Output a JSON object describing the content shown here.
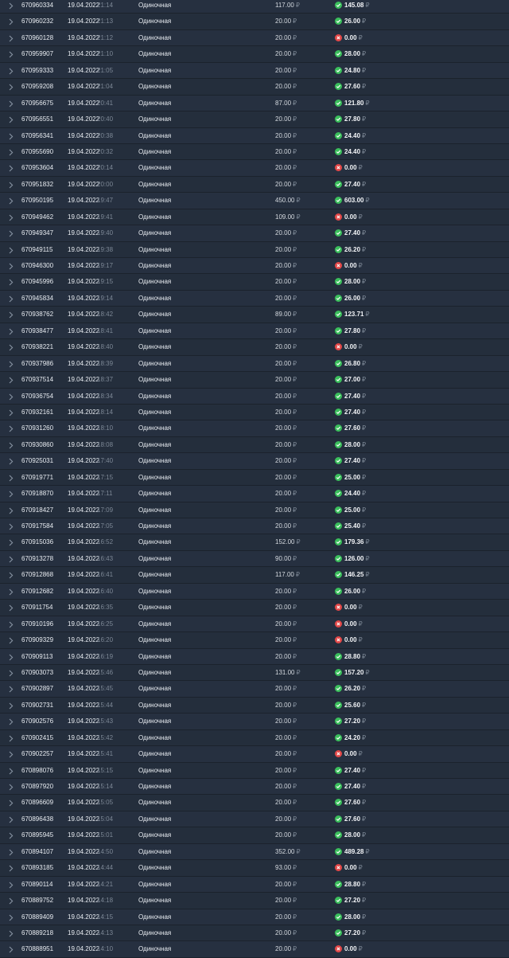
{
  "currency_symbol": "₽",
  "colors": {
    "won": "#3bbf5c",
    "lost": "#e34848",
    "background": "#232c38"
  },
  "icons": {
    "expand": "chevron-right-icon",
    "won": "check-circle-icon",
    "lost": "cross-circle-icon"
  },
  "bets": [
    {
      "id": "670960334",
      "date": "19.04.2022",
      "time": "21:14",
      "type": "Одиночная",
      "stake": "117.00",
      "payout": "145.08",
      "status": "won"
    },
    {
      "id": "670960232",
      "date": "19.04.2022",
      "time": "21:13",
      "type": "Одиночная",
      "stake": "20.00",
      "payout": "26.00",
      "status": "won"
    },
    {
      "id": "670960128",
      "date": "19.04.2022",
      "time": "21:12",
      "type": "Одиночная",
      "stake": "20.00",
      "payout": "0.00",
      "status": "lost"
    },
    {
      "id": "670959907",
      "date": "19.04.2022",
      "time": "21:10",
      "type": "Одиночная",
      "stake": "20.00",
      "payout": "28.00",
      "status": "won"
    },
    {
      "id": "670959333",
      "date": "19.04.2022",
      "time": "21:05",
      "type": "Одиночная",
      "stake": "20.00",
      "payout": "24.80",
      "status": "won"
    },
    {
      "id": "670959208",
      "date": "19.04.2022",
      "time": "21:04",
      "type": "Одиночная",
      "stake": "20.00",
      "payout": "27.60",
      "status": "won"
    },
    {
      "id": "670956675",
      "date": "19.04.2022",
      "time": "20:41",
      "type": "Одиночная",
      "stake": "87.00",
      "payout": "121.80",
      "status": "won"
    },
    {
      "id": "670956551",
      "date": "19.04.2022",
      "time": "20:40",
      "type": "Одиночная",
      "stake": "20.00",
      "payout": "27.80",
      "status": "won"
    },
    {
      "id": "670956341",
      "date": "19.04.2022",
      "time": "20:38",
      "type": "Одиночная",
      "stake": "20.00",
      "payout": "24.40",
      "status": "won"
    },
    {
      "id": "670955690",
      "date": "19.04.2022",
      "time": "20:32",
      "type": "Одиночная",
      "stake": "20.00",
      "payout": "24.40",
      "status": "won"
    },
    {
      "id": "670953604",
      "date": "19.04.2022",
      "time": "20:14",
      "type": "Одиночная",
      "stake": "20.00",
      "payout": "0.00",
      "status": "lost"
    },
    {
      "id": "670951832",
      "date": "19.04.2022",
      "time": "20:00",
      "type": "Одиночная",
      "stake": "20.00",
      "payout": "27.40",
      "status": "won"
    },
    {
      "id": "670950195",
      "date": "19.04.2022",
      "time": "19:47",
      "type": "Одиночная",
      "stake": "450.00",
      "payout": "603.00",
      "status": "won"
    },
    {
      "id": "670949462",
      "date": "19.04.2022",
      "time": "19:41",
      "type": "Одиночная",
      "stake": "109.00",
      "payout": "0.00",
      "status": "lost"
    },
    {
      "id": "670949347",
      "date": "19.04.2022",
      "time": "19:40",
      "type": "Одиночная",
      "stake": "20.00",
      "payout": "27.40",
      "status": "won"
    },
    {
      "id": "670949115",
      "date": "19.04.2022",
      "time": "19:38",
      "type": "Одиночная",
      "stake": "20.00",
      "payout": "26.20",
      "status": "won"
    },
    {
      "id": "670946300",
      "date": "19.04.2022",
      "time": "19:17",
      "type": "Одиночная",
      "stake": "20.00",
      "payout": "0.00",
      "status": "lost"
    },
    {
      "id": "670945996",
      "date": "19.04.2022",
      "time": "19:15",
      "type": "Одиночная",
      "stake": "20.00",
      "payout": "28.00",
      "status": "won"
    },
    {
      "id": "670945834",
      "date": "19.04.2022",
      "time": "19:14",
      "type": "Одиночная",
      "stake": "20.00",
      "payout": "26.00",
      "status": "won"
    },
    {
      "id": "670938762",
      "date": "19.04.2022",
      "time": "18:42",
      "type": "Одиночная",
      "stake": "89.00",
      "payout": "123.71",
      "status": "won"
    },
    {
      "id": "670938477",
      "date": "19.04.2022",
      "time": "18:41",
      "type": "Одиночная",
      "stake": "20.00",
      "payout": "27.80",
      "status": "won"
    },
    {
      "id": "670938221",
      "date": "19.04.2022",
      "time": "18:40",
      "type": "Одиночная",
      "stake": "20.00",
      "payout": "0.00",
      "status": "lost"
    },
    {
      "id": "670937986",
      "date": "19.04.2022",
      "time": "18:39",
      "type": "Одиночная",
      "stake": "20.00",
      "payout": "26.80",
      "status": "won"
    },
    {
      "id": "670937514",
      "date": "19.04.2022",
      "time": "18:37",
      "type": "Одиночная",
      "stake": "20.00",
      "payout": "27.00",
      "status": "won"
    },
    {
      "id": "670936754",
      "date": "19.04.2022",
      "time": "18:34",
      "type": "Одиночная",
      "stake": "20.00",
      "payout": "27.40",
      "status": "won"
    },
    {
      "id": "670932161",
      "date": "19.04.2022",
      "time": "18:14",
      "type": "Одиночная",
      "stake": "20.00",
      "payout": "27.40",
      "status": "won"
    },
    {
      "id": "670931260",
      "date": "19.04.2022",
      "time": "18:10",
      "type": "Одиночная",
      "stake": "20.00",
      "payout": "27.60",
      "status": "won"
    },
    {
      "id": "670930860",
      "date": "19.04.2022",
      "time": "18:08",
      "type": "Одиночная",
      "stake": "20.00",
      "payout": "28.00",
      "status": "won"
    },
    {
      "id": "670925031",
      "date": "19.04.2022",
      "time": "17:40",
      "type": "Одиночная",
      "stake": "20.00",
      "payout": "27.40",
      "status": "won"
    },
    {
      "id": "670919771",
      "date": "19.04.2022",
      "time": "17:15",
      "type": "Одиночная",
      "stake": "20.00",
      "payout": "25.00",
      "status": "won"
    },
    {
      "id": "670918870",
      "date": "19.04.2022",
      "time": "17:11",
      "type": "Одиночная",
      "stake": "20.00",
      "payout": "24.40",
      "status": "won"
    },
    {
      "id": "670918427",
      "date": "19.04.2022",
      "time": "17:09",
      "type": "Одиночная",
      "stake": "20.00",
      "payout": "25.00",
      "status": "won"
    },
    {
      "id": "670917584",
      "date": "19.04.2022",
      "time": "17:05",
      "type": "Одиночная",
      "stake": "20.00",
      "payout": "25.40",
      "status": "won"
    },
    {
      "id": "670915036",
      "date": "19.04.2022",
      "time": "16:52",
      "type": "Одиночная",
      "stake": "152.00",
      "payout": "179.36",
      "status": "won"
    },
    {
      "id": "670913278",
      "date": "19.04.2022",
      "time": "16:43",
      "type": "Одиночная",
      "stake": "90.00",
      "payout": "126.00",
      "status": "won"
    },
    {
      "id": "670912868",
      "date": "19.04.2022",
      "time": "16:41",
      "type": "Одиночная",
      "stake": "117.00",
      "payout": "146.25",
      "status": "won"
    },
    {
      "id": "670912682",
      "date": "19.04.2022",
      "time": "16:40",
      "type": "Одиночная",
      "stake": "20.00",
      "payout": "26.00",
      "status": "won"
    },
    {
      "id": "670911754",
      "date": "19.04.2022",
      "time": "16:35",
      "type": "Одиночная",
      "stake": "20.00",
      "payout": "0.00",
      "status": "lost"
    },
    {
      "id": "670910196",
      "date": "19.04.2022",
      "time": "16:25",
      "type": "Одиночная",
      "stake": "20.00",
      "payout": "0.00",
      "status": "lost"
    },
    {
      "id": "670909329",
      "date": "19.04.2022",
      "time": "16:20",
      "type": "Одиночная",
      "stake": "20.00",
      "payout": "0.00",
      "status": "lost"
    },
    {
      "id": "670909113",
      "date": "19.04.2022",
      "time": "16:19",
      "type": "Одиночная",
      "stake": "20.00",
      "payout": "28.80",
      "status": "won"
    },
    {
      "id": "670903073",
      "date": "19.04.2022",
      "time": "15:46",
      "type": "Одиночная",
      "stake": "131.00",
      "payout": "157.20",
      "status": "won"
    },
    {
      "id": "670902897",
      "date": "19.04.2022",
      "time": "15:45",
      "type": "Одиночная",
      "stake": "20.00",
      "payout": "26.20",
      "status": "won"
    },
    {
      "id": "670902731",
      "date": "19.04.2022",
      "time": "15:44",
      "type": "Одиночная",
      "stake": "20.00",
      "payout": "25.60",
      "status": "won"
    },
    {
      "id": "670902576",
      "date": "19.04.2022",
      "time": "15:43",
      "type": "Одиночная",
      "stake": "20.00",
      "payout": "27.20",
      "status": "won"
    },
    {
      "id": "670902415",
      "date": "19.04.2022",
      "time": "15:42",
      "type": "Одиночная",
      "stake": "20.00",
      "payout": "24.20",
      "status": "won"
    },
    {
      "id": "670902257",
      "date": "19.04.2022",
      "time": "15:41",
      "type": "Одиночная",
      "stake": "20.00",
      "payout": "0.00",
      "status": "lost"
    },
    {
      "id": "670898076",
      "date": "19.04.2022",
      "time": "15:15",
      "type": "Одиночная",
      "stake": "20.00",
      "payout": "27.40",
      "status": "won"
    },
    {
      "id": "670897920",
      "date": "19.04.2022",
      "time": "15:14",
      "type": "Одиночная",
      "stake": "20.00",
      "payout": "27.40",
      "status": "won"
    },
    {
      "id": "670896609",
      "date": "19.04.2022",
      "time": "15:05",
      "type": "Одиночная",
      "stake": "20.00",
      "payout": "27.60",
      "status": "won"
    },
    {
      "id": "670896438",
      "date": "19.04.2022",
      "time": "15:04",
      "type": "Одиночная",
      "stake": "20.00",
      "payout": "27.60",
      "status": "won"
    },
    {
      "id": "670895945",
      "date": "19.04.2022",
      "time": "15:01",
      "type": "Одиночная",
      "stake": "20.00",
      "payout": "28.00",
      "status": "won"
    },
    {
      "id": "670894107",
      "date": "19.04.2022",
      "time": "14:50",
      "type": "Одиночная",
      "stake": "352.00",
      "payout": "489.28",
      "status": "won"
    },
    {
      "id": "670893185",
      "date": "19.04.2022",
      "time": "14:44",
      "type": "Одиночная",
      "stake": "93.00",
      "payout": "0.00",
      "status": "lost"
    },
    {
      "id": "670890114",
      "date": "19.04.2022",
      "time": "14:21",
      "type": "Одиночная",
      "stake": "20.00",
      "payout": "28.80",
      "status": "won"
    },
    {
      "id": "670889752",
      "date": "19.04.2022",
      "time": "14:18",
      "type": "Одиночная",
      "stake": "20.00",
      "payout": "27.20",
      "status": "won"
    },
    {
      "id": "670889409",
      "date": "19.04.2022",
      "time": "14:15",
      "type": "Одиночная",
      "stake": "20.00",
      "payout": "28.00",
      "status": "won"
    },
    {
      "id": "670889218",
      "date": "19.04.2022",
      "time": "14:13",
      "type": "Одиночная",
      "stake": "20.00",
      "payout": "27.20",
      "status": "won"
    },
    {
      "id": "670888951",
      "date": "19.04.2022",
      "time": "14:10",
      "type": "Одиночная",
      "stake": "20.00",
      "payout": "0.00",
      "status": "lost"
    }
  ]
}
